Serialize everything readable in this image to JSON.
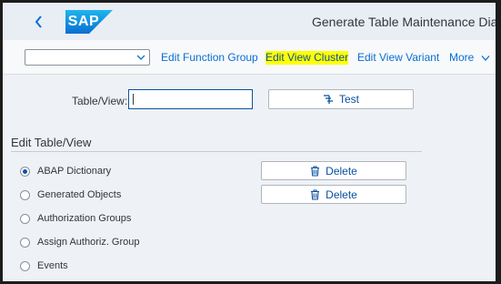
{
  "shell": {
    "logo_text": "SAP",
    "title": "Generate Table Maintenance Dialog",
    "brand_color": "#0a6ed1"
  },
  "toolbar": {
    "select_value": "",
    "buttons": [
      {
        "label": "Edit Function Group"
      },
      {
        "label": "Edit View Cluster",
        "highlighted": true
      },
      {
        "label": "Edit View Variant"
      },
      {
        "label": "More"
      }
    ]
  },
  "form": {
    "table_view_label": "Table/View:",
    "table_view_value": "",
    "test_label": "Test"
  },
  "section": {
    "title": "Edit Table/View",
    "options": [
      {
        "label": "ABAP Dictionary",
        "checked": true
      },
      {
        "label": "Generated Objects",
        "checked": false
      },
      {
        "label": "Authorization Groups",
        "checked": false
      },
      {
        "label": "Assign Authoriz. Group",
        "checked": false
      },
      {
        "label": "Events",
        "checked": false
      }
    ],
    "delete_label": "Delete"
  },
  "icons": {
    "back": "chevron-left-icon",
    "caret": "chevron-down-icon",
    "test": "test-icon",
    "delete": "trash-icon"
  }
}
